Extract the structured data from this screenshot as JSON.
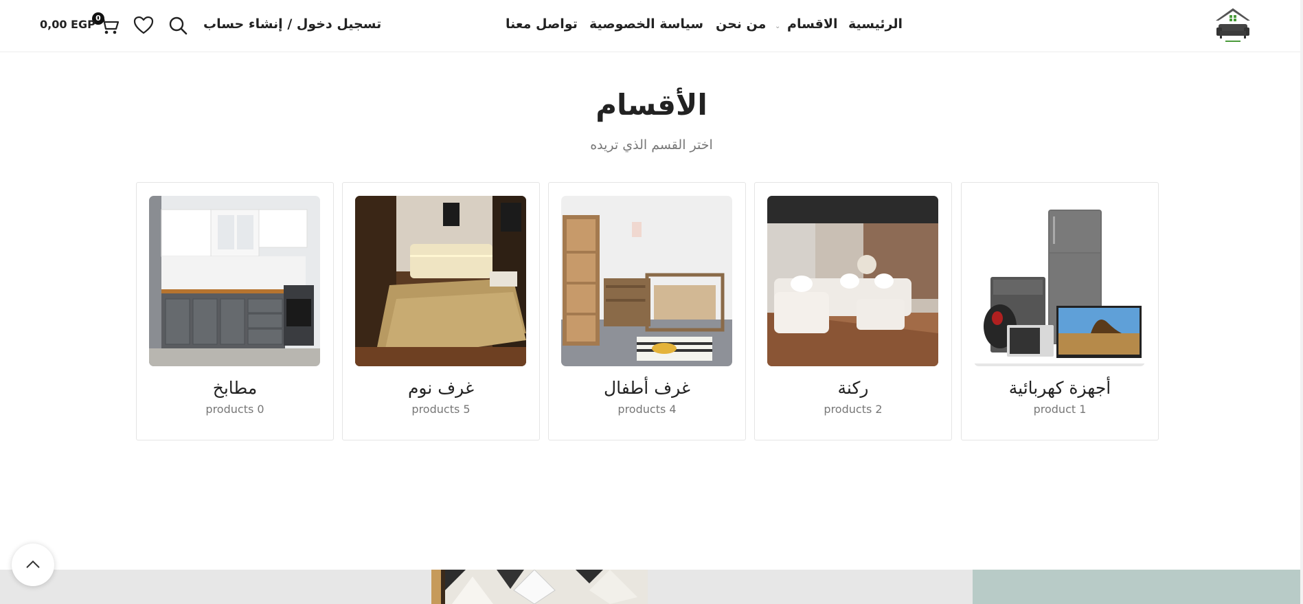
{
  "header": {
    "nav": {
      "home": "الرئيسية",
      "categories": "الاقسام",
      "about": "من نحن",
      "privacy": "سياسة الخصوصية",
      "contact": "تواصل معنا"
    },
    "login_label": "تسجيل دخول / إنشاء حساب",
    "cart_count": "0",
    "cart_total": "0,00 EGP",
    "icons": [
      "logo-house-icon",
      "search-icon",
      "heart-icon",
      "cart-icon"
    ]
  },
  "main": {
    "title": "الأقسام",
    "subtitle": "اختر القسم الذي تريده",
    "categories": [
      {
        "name": "أجهزة كهربائية",
        "count": "product 1"
      },
      {
        "name": "ركنة",
        "count": "products 2"
      },
      {
        "name": "غرف أطفال",
        "count": "products 4"
      },
      {
        "name": "غرف نوم",
        "count": "products 5"
      },
      {
        "name": "مطابخ",
        "count": "products 0"
      }
    ]
  },
  "colors": {
    "text": "#222222",
    "muted": "#777777",
    "logo_green": "#4a9a3a",
    "bottom_left_bg": "#e7e7e7",
    "bottom_right_bg": "#b8cbc7"
  }
}
